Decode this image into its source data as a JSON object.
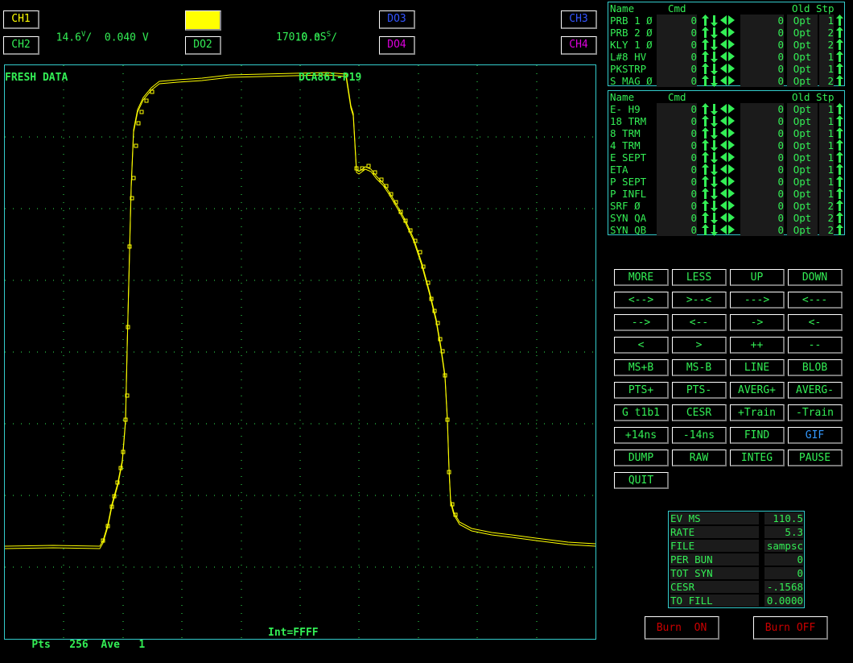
{
  "colors": {
    "trace": "#ffff00",
    "text": "#33ee55",
    "frame": "#33cccc",
    "grid": "#33ee55",
    "ch1": "#ffff00",
    "ch2": "#33ee55",
    "do3": "#3355ff",
    "do4": "#dd00dd",
    "ch3": "#3355ff",
    "ch4": "#dd00dd",
    "burn": "#cc0000",
    "gif": "#3399ff"
  },
  "top": {
    "ch1": "CH1",
    "ch2": "CH2",
    "do2": "DO2",
    "do3": "DO3",
    "do4": "DO4",
    "ch3": "CH3",
    "ch4": "CH4",
    "vscale": "14.6",
    "vunit": "V",
    "voffset": "0.040 V",
    "tscale": "10.0",
    "tunit": "S",
    "tdelay": "170.0 nS"
  },
  "scope": {
    "status": "FRESH DATA",
    "device": "DCA861-P19",
    "pts_label": "Pts",
    "pts_value": "256",
    "ave_label": "Ave",
    "ave_value": "1",
    "int_label": "Int=FFFF"
  },
  "knobs1": {
    "header": {
      "name": "Name",
      "cmd": "Cmd",
      "old": "Old",
      "stp": "Stp"
    },
    "rows": [
      {
        "name": "PRB 1 Ø",
        "cmd": "0",
        "old": "0",
        "type": "Opt",
        "stp": "1"
      },
      {
        "name": "PRB 2 Ø",
        "cmd": "0",
        "old": "0",
        "type": "Opt",
        "stp": "2"
      },
      {
        "name": "KLY 1 Ø",
        "cmd": "0",
        "old": "0",
        "type": "Opt",
        "stp": "2"
      },
      {
        "name": "L#8 HV",
        "cmd": "0",
        "old": "0",
        "type": "Opt",
        "stp": "1"
      },
      {
        "name": "PKSTRP",
        "cmd": "0",
        "old": "0",
        "type": "Opt",
        "stp": "1"
      },
      {
        "name": "S MAG Ø",
        "cmd": "0",
        "old": "0",
        "type": "Opt",
        "stp": "2"
      }
    ]
  },
  "knobs2": {
    "header": {
      "name": "Name",
      "cmd": "Cmd",
      "old": "Old",
      "stp": "Stp"
    },
    "rows": [
      {
        "name": "E- H9",
        "cmd": "0",
        "old": "0",
        "type": "Opt",
        "stp": "1"
      },
      {
        "name": "18 TRM",
        "cmd": "0",
        "old": "0",
        "type": "Opt",
        "stp": "1"
      },
      {
        "name": "8 TRM",
        "cmd": "0",
        "old": "0",
        "type": "Opt",
        "stp": "1"
      },
      {
        "name": "4 TRM",
        "cmd": "0",
        "old": "0",
        "type": "Opt",
        "stp": "1"
      },
      {
        "name": "E SEPT",
        "cmd": "0",
        "old": "0",
        "type": "Opt",
        "stp": "1"
      },
      {
        "name": "ETA",
        "cmd": "0",
        "old": "0",
        "type": "Opt",
        "stp": "1"
      },
      {
        "name": "P SEPT",
        "cmd": "0",
        "old": "0",
        "type": "Opt",
        "stp": "1"
      },
      {
        "name": "P INFL",
        "cmd": "0",
        "old": "0",
        "type": "Opt",
        "stp": "1"
      },
      {
        "name": "SRF Ø",
        "cmd": "0",
        "old": "0",
        "type": "Opt",
        "stp": "2"
      },
      {
        "name": "SYN QA",
        "cmd": "0",
        "old": "0",
        "type": "Opt",
        "stp": "2"
      },
      {
        "name": "SYN QB",
        "cmd": "0",
        "old": "0",
        "type": "Opt",
        "stp": "2"
      }
    ]
  },
  "buttons": [
    [
      "MORE",
      "LESS",
      "UP",
      "DOWN"
    ],
    [
      "<-->",
      ">--<",
      "--->",
      "<---"
    ],
    [
      "-->",
      "<--",
      "->",
      "<-"
    ],
    [
      "<",
      ">",
      "++",
      "--"
    ],
    [
      "MS+B",
      "MS-B",
      "LINE",
      "BLOB"
    ],
    [
      "PTS+",
      "PTS-",
      "AVERG+",
      "AVERG-"
    ],
    [
      "G t1b1",
      "CESR",
      "+Train",
      "-Train"
    ],
    [
      "+14ns",
      "-14ns",
      "FIND",
      "GIF"
    ],
    [
      "DUMP",
      "RAW",
      "INTEG",
      "PAUSE"
    ],
    [
      "QUIT"
    ]
  ],
  "status": [
    {
      "label": "EV MS",
      "value": "110.5"
    },
    {
      "label": "RATE",
      "value": "5.3"
    },
    {
      "label": "FILE",
      "value": "sampsc"
    },
    {
      "label": "PER BUN",
      "value": "0"
    },
    {
      "label": "TOT SYN",
      "value": "0"
    },
    {
      "label": "CESR",
      "value": "-.1568"
    },
    {
      "label": "TO FILL",
      "value": "0.0000"
    }
  ],
  "burn": {
    "on": "Burn  ON",
    "off": "Burn OFF"
  }
}
